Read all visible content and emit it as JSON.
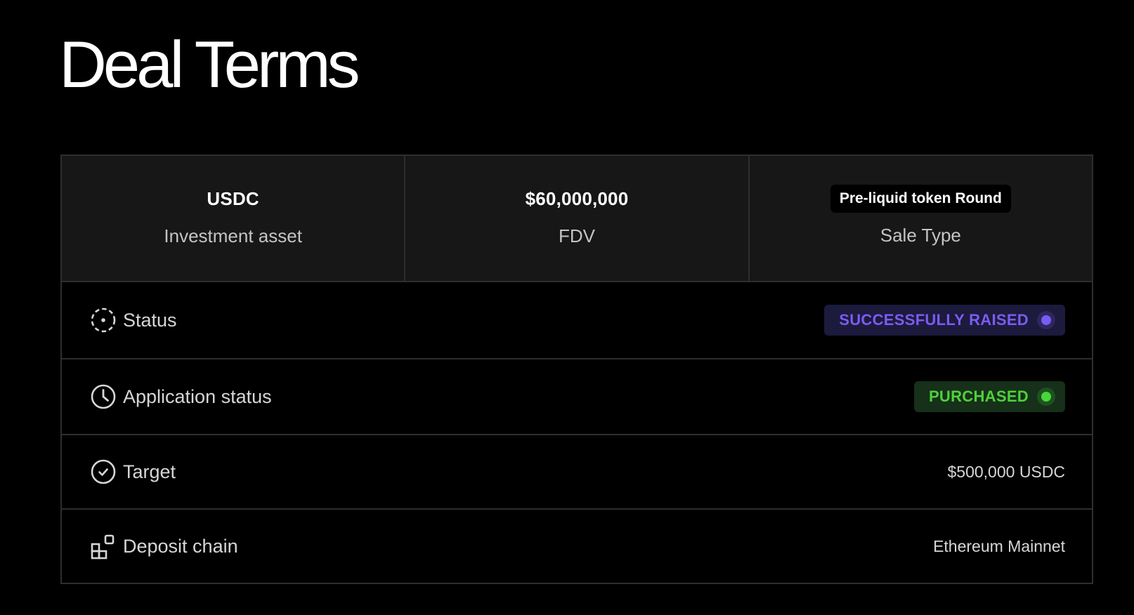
{
  "page": {
    "title": "Deal Terms"
  },
  "summary": [
    {
      "value": "USDC",
      "label": "Investment asset"
    },
    {
      "value": "$60,000,000",
      "label": "FDV"
    },
    {
      "value": "Pre-liquid token Round",
      "label": "Sale Type"
    }
  ],
  "rows": {
    "status": {
      "icon": "dashed-circle-icon",
      "label": "Status",
      "badge": "SUCCESSFULLY RAISED",
      "badge_text_color": "#7b5cf0",
      "badge_bg_color": "#1c1a3d",
      "badge_dot_color": "#7b5cf0"
    },
    "application_status": {
      "icon": "clock-icon",
      "label": "Application status",
      "badge": "PURCHASED",
      "badge_text_color": "#4fd13a",
      "badge_bg_color": "#16301a",
      "badge_dot_color": "#46d63a"
    },
    "target": {
      "icon": "check-circle-icon",
      "label": "Target",
      "value": "$500,000 USDC"
    },
    "deposit_chain": {
      "icon": "blocks-icon",
      "label": "Deposit chain",
      "value": "Ethereum Mainnet"
    }
  },
  "colors": {
    "background": "#000000",
    "summary_background": "#171717",
    "border": "#2e2e2e",
    "primary_text": "#ffffff",
    "secondary_text": "#c4c4c4"
  }
}
